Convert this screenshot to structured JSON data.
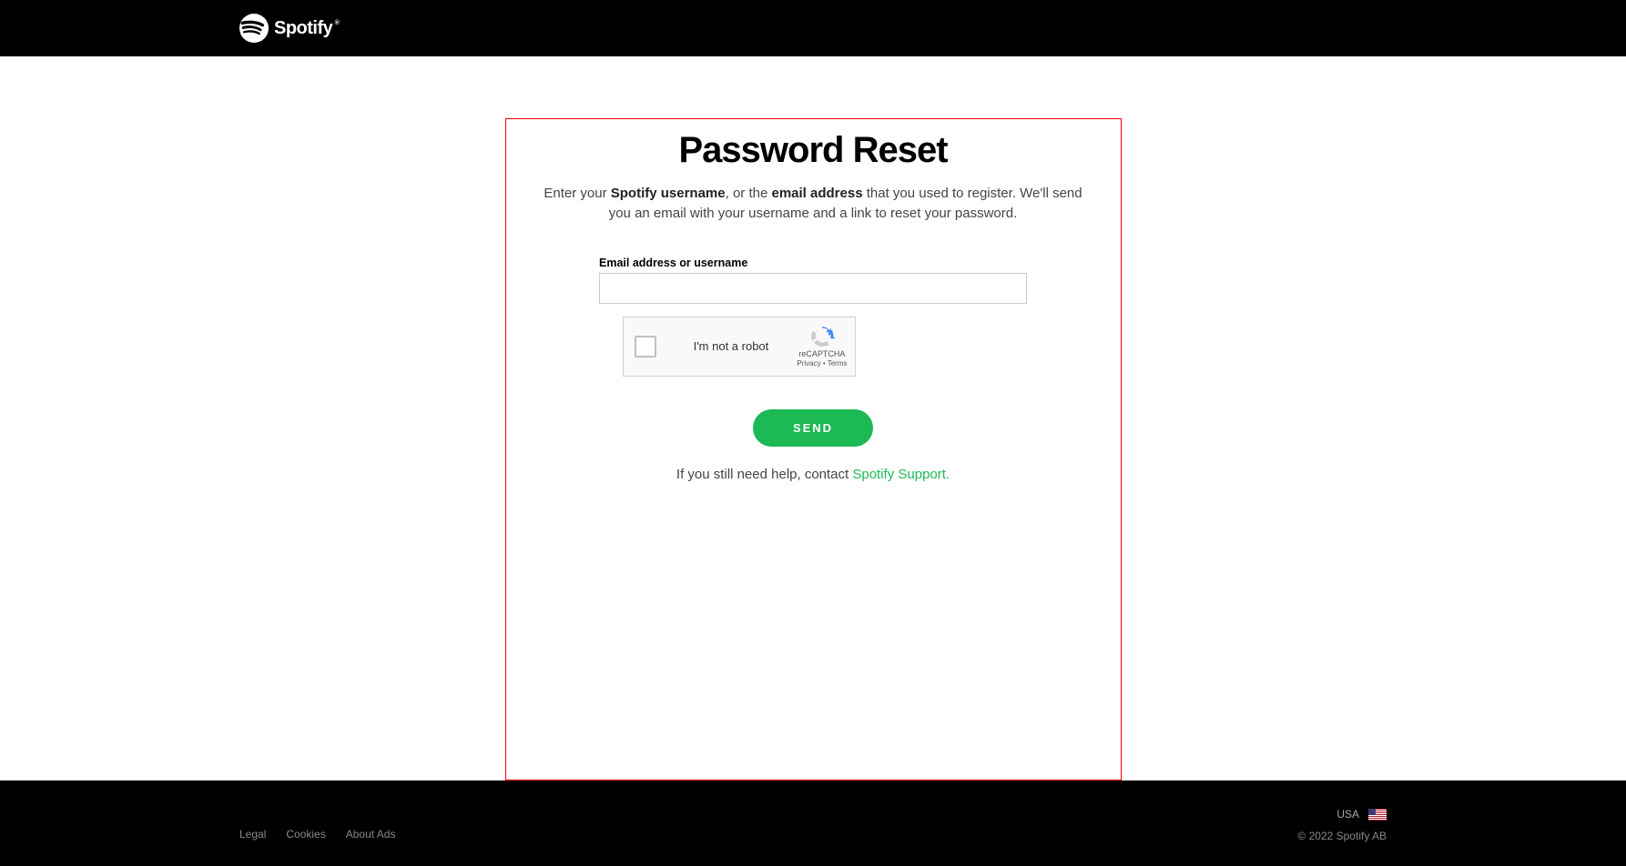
{
  "header": {
    "brand": "Spotify"
  },
  "card": {
    "title": "Password Reset",
    "desc_prefix": "Enter your ",
    "desc_bold1": "Spotify username",
    "desc_mid": ", or the ",
    "desc_bold2": "email address",
    "desc_suffix": " that you used to register. We'll send you an email with your username and a link to reset your password.",
    "input_label": "Email address or username",
    "input_value": "",
    "send_label": "SEND",
    "help_text": "If you still need help, contact ",
    "help_link": "Spotify Support."
  },
  "recaptcha": {
    "label": "I'm not a robot",
    "brand": "reCAPTCHA",
    "privacy": "Privacy",
    "separator": " • ",
    "terms": "Terms"
  },
  "footer": {
    "links": {
      "legal": "Legal",
      "cookies": "Cookies",
      "about_ads": "About Ads"
    },
    "country": "USA",
    "copyright": "© 2022 Spotify AB"
  }
}
